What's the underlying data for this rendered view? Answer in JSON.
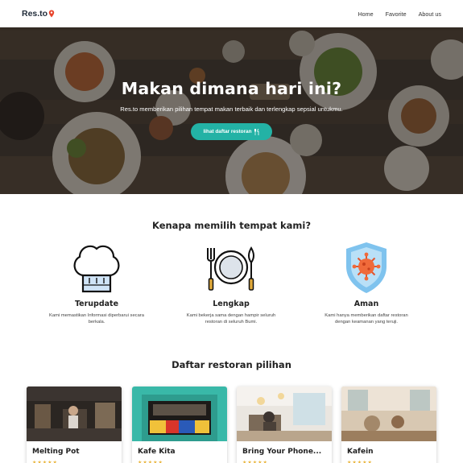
{
  "nav": {
    "logo_text": "Res.to",
    "links": [
      "Home",
      "Favorite",
      "About us"
    ]
  },
  "hero": {
    "title": "Makan dimana hari ini?",
    "subtitle": "Res.to memberikan pilihan tempat makan terbaik dan terlengkap sepsial untukmu.",
    "cta_label": "lihat daftar restoran",
    "cta_icon": "utensils-icon"
  },
  "why": {
    "title": "Kenapa memilih tempat kami?",
    "features": [
      {
        "icon": "chef-hat-icon",
        "title": "Terupdate",
        "desc": "Kami memastikan Informasi diperbarui secara berkala."
      },
      {
        "icon": "plate-cutlery-icon",
        "title": "Lengkap",
        "desc": "Kami bekerja sama dengan hampir seluruh restoran di seluruh Bumi."
      },
      {
        "icon": "virus-shield-icon",
        "title": "Aman",
        "desc": "Kami hanya memberikan daftar restoran dengan keamanan yang teruji."
      }
    ]
  },
  "restaurants": {
    "title": "Daftar restoran pilihan",
    "items": [
      {
        "name": "Melting Pot",
        "rating_stars": "★★★★★"
      },
      {
        "name": "Kafe Kita",
        "rating_stars": "★★★★★"
      },
      {
        "name": "Bring Your Phone...",
        "rating_stars": "★★★★★"
      },
      {
        "name": "Kafein",
        "rating_stars": "★★★★★"
      }
    ]
  },
  "colors": {
    "accent": "#23b2a5",
    "logo_pin": "#e8452c",
    "star": "#e9b53d"
  }
}
